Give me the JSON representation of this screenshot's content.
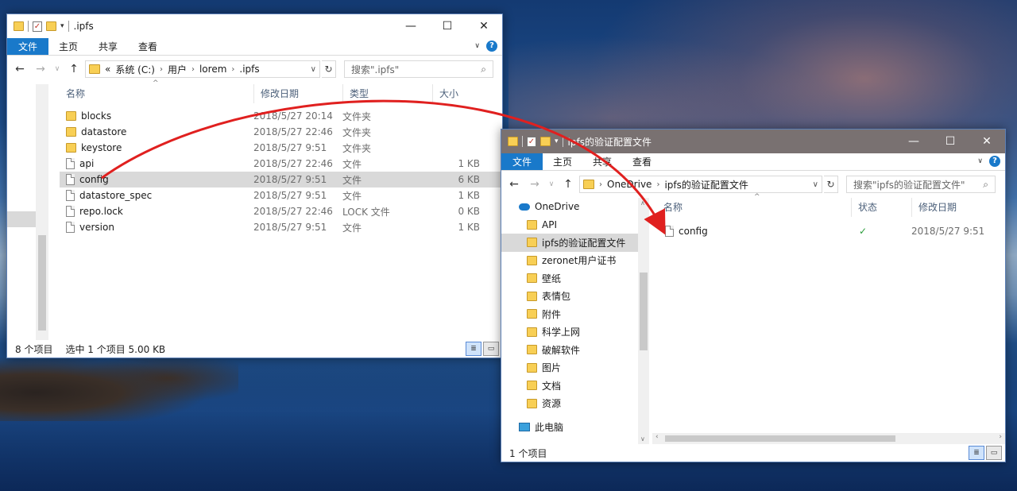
{
  "left_window": {
    "title": ".ipfs",
    "controls": {
      "minimize": "—",
      "maximize": "☐",
      "close": "✕"
    },
    "ribbon_tabs": [
      "文件",
      "主页",
      "共享",
      "查看"
    ],
    "breadcrumb": [
      "«",
      "系统 (C:)",
      "用户",
      "lorem",
      ".ipfs"
    ],
    "search_placeholder": "搜索\".ipfs\"",
    "columns": [
      "名称",
      "修改日期",
      "类型",
      "大小"
    ],
    "rows": [
      {
        "name": "blocks",
        "date": "2018/5/27 20:14",
        "type": "文件夹",
        "size": "",
        "icon": "folder-icon"
      },
      {
        "name": "datastore",
        "date": "2018/5/27 22:46",
        "type": "文件夹",
        "size": "",
        "icon": "folder-icon"
      },
      {
        "name": "keystore",
        "date": "2018/5/27 9:51",
        "type": "文件夹",
        "size": "",
        "icon": "folder-icon"
      },
      {
        "name": "api",
        "date": "2018/5/27 22:46",
        "type": "文件",
        "size": "1 KB",
        "icon": "file-icon"
      },
      {
        "name": "config",
        "date": "2018/5/27 9:51",
        "type": "文件",
        "size": "6 KB",
        "icon": "file-icon",
        "selected": true
      },
      {
        "name": "datastore_spec",
        "date": "2018/5/27 9:51",
        "type": "文件",
        "size": "1 KB",
        "icon": "file-icon"
      },
      {
        "name": "repo.lock",
        "date": "2018/5/27 22:46",
        "type": "LOCK 文件",
        "size": "0 KB",
        "icon": "file-icon"
      },
      {
        "name": "version",
        "date": "2018/5/27 9:51",
        "type": "文件",
        "size": "1 KB",
        "icon": "file-icon"
      }
    ],
    "status_count": "8 个项目",
    "status_selection": "选中 1 个项目  5.00 KB"
  },
  "right_window": {
    "title": "ipfs的验证配置文件",
    "controls": {
      "minimize": "—",
      "maximize": "☐",
      "close": "✕"
    },
    "ribbon_tabs": [
      "文件",
      "主页",
      "共享",
      "查看"
    ],
    "breadcrumb": [
      "OneDrive",
      "ipfs的验证配置文件"
    ],
    "search_placeholder": "搜索\"ipfs的验证配置文件\"",
    "tree": {
      "root": "OneDrive",
      "items": [
        "API",
        "ipfs的验证配置文件",
        "zeronet用户证书",
        "壁纸",
        "表情包",
        "附件",
        "科学上网",
        "破解软件",
        "图片",
        "文档",
        "资源"
      ],
      "selected_index": 1,
      "this_pc": "此电脑"
    },
    "columns": [
      "名称",
      "状态",
      "修改日期"
    ],
    "rows": [
      {
        "name": "config",
        "status": "✓",
        "date": "2018/5/27 9:51"
      }
    ],
    "status_count": "1 个项目"
  },
  "colors": {
    "accent": "#1979ca",
    "arrow": "#e0201f",
    "selection": "#d9d9d9"
  }
}
